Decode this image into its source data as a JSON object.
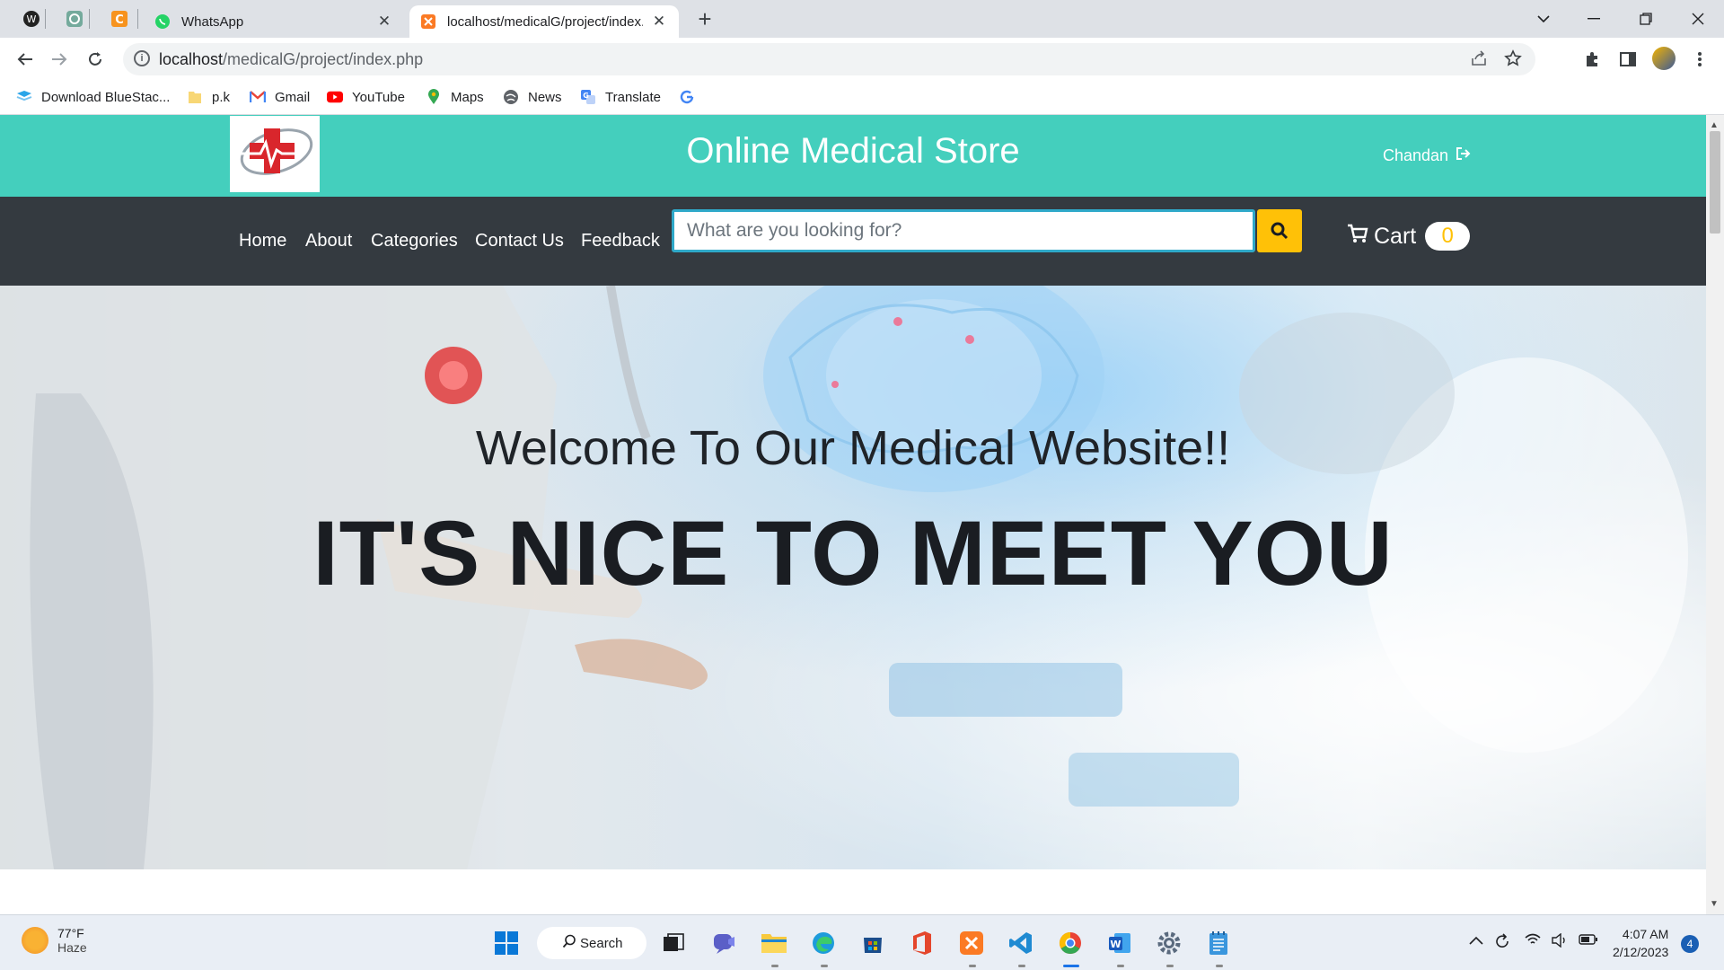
{
  "browser": {
    "tabs": [
      {
        "title": "WhatsApp",
        "close": "✕"
      },
      {
        "title": "localhost/medicalG/project/index.php",
        "close": "✕"
      }
    ],
    "new_tab": "+",
    "url_host": "localhost",
    "url_path": "/medicalG/project/index.php"
  },
  "bookmarks": [
    {
      "label": "Download BlueStac...",
      "icon": "bluestacks-icon"
    },
    {
      "label": "p.k",
      "icon": "folder-icon"
    },
    {
      "label": "Gmail",
      "icon": "gmail-icon"
    },
    {
      "label": "YouTube",
      "icon": "youtube-icon"
    },
    {
      "label": "Maps",
      "icon": "maps-icon"
    },
    {
      "label": "News",
      "icon": "news-icon"
    },
    {
      "label": "Translate",
      "icon": "translate-icon"
    }
  ],
  "site": {
    "title": "Online Medical Store",
    "user": "Chandan",
    "nav": [
      "Home",
      "About",
      "Categories",
      "Contact Us",
      "Feedback"
    ],
    "search_placeholder": "What are you looking for?",
    "cart_label": "Cart",
    "cart_count": "0",
    "hero_line1": "Welcome To Our Medical Website!!",
    "hero_line2": "IT'S NICE TO MEET YOU"
  },
  "taskbar": {
    "weather_temp": "77°F",
    "weather_desc": "Haze",
    "search_label": "Search",
    "time": "4:07 AM",
    "date": "2/12/2023",
    "notification_count": "4"
  },
  "colors": {
    "header": "#44cfbd",
    "navbar": "#343a40",
    "search_button": "#ffc107",
    "cart_badge_text": "#ffc107"
  }
}
